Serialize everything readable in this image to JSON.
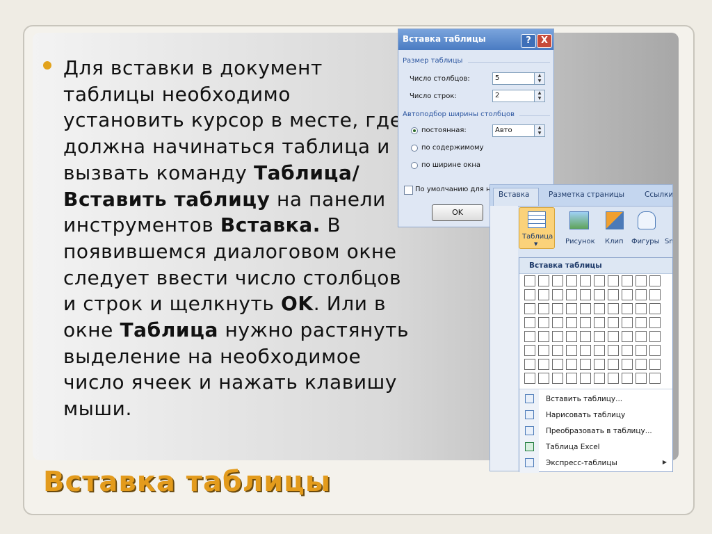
{
  "slide": {
    "body_parts": [
      "Для вставки в документ таблицы необходимо установить курсор в месте, где должна начинаться таблица и вызвать команду ",
      "Таблица/Вставить таблицу",
      " на панели инструментов ",
      "Вставка.",
      " В появившемся диалоговом окне следует ввести число столбцов и строк и щелкнуть ",
      "OK",
      ". Или в окне ",
      "Таблица",
      " нужно растянуть выделение на необходимое число ячеек и нажать клавишу мыши."
    ],
    "title": "Вставка таблицы"
  },
  "dialog": {
    "title": "Вставка таблицы",
    "help": "?",
    "close": "X",
    "size_group": "Размер таблицы",
    "cols_label": "Число столбцов:",
    "cols_value": "5",
    "rows_label": "Число строк:",
    "rows_value": "2",
    "autofit_group": "Автоподбор ширины столбцов",
    "fixed_label": "постоянная:",
    "fixed_value": "Авто",
    "content_label": "по содержимому",
    "window_label": "по ширине окна",
    "default_label": "По умолчанию для н",
    "ok": "OK"
  },
  "ribbon": {
    "tabs": [
      "Вставка",
      "Разметка страницы",
      "Ссылки"
    ],
    "buttons": {
      "table": "Таблица",
      "picture": "Рисунок",
      "clip": "Клип",
      "shapes": "Фигуры",
      "smart": "Sm"
    }
  },
  "dropdown": {
    "title": "Вставка таблицы",
    "grid_cols": 10,
    "grid_rows": 8,
    "items": [
      "Вставить таблицу...",
      "Нарисовать таблицу",
      "Преобразовать в таблицу...",
      "Таблица Excel",
      "Экспресс-таблицы"
    ]
  }
}
